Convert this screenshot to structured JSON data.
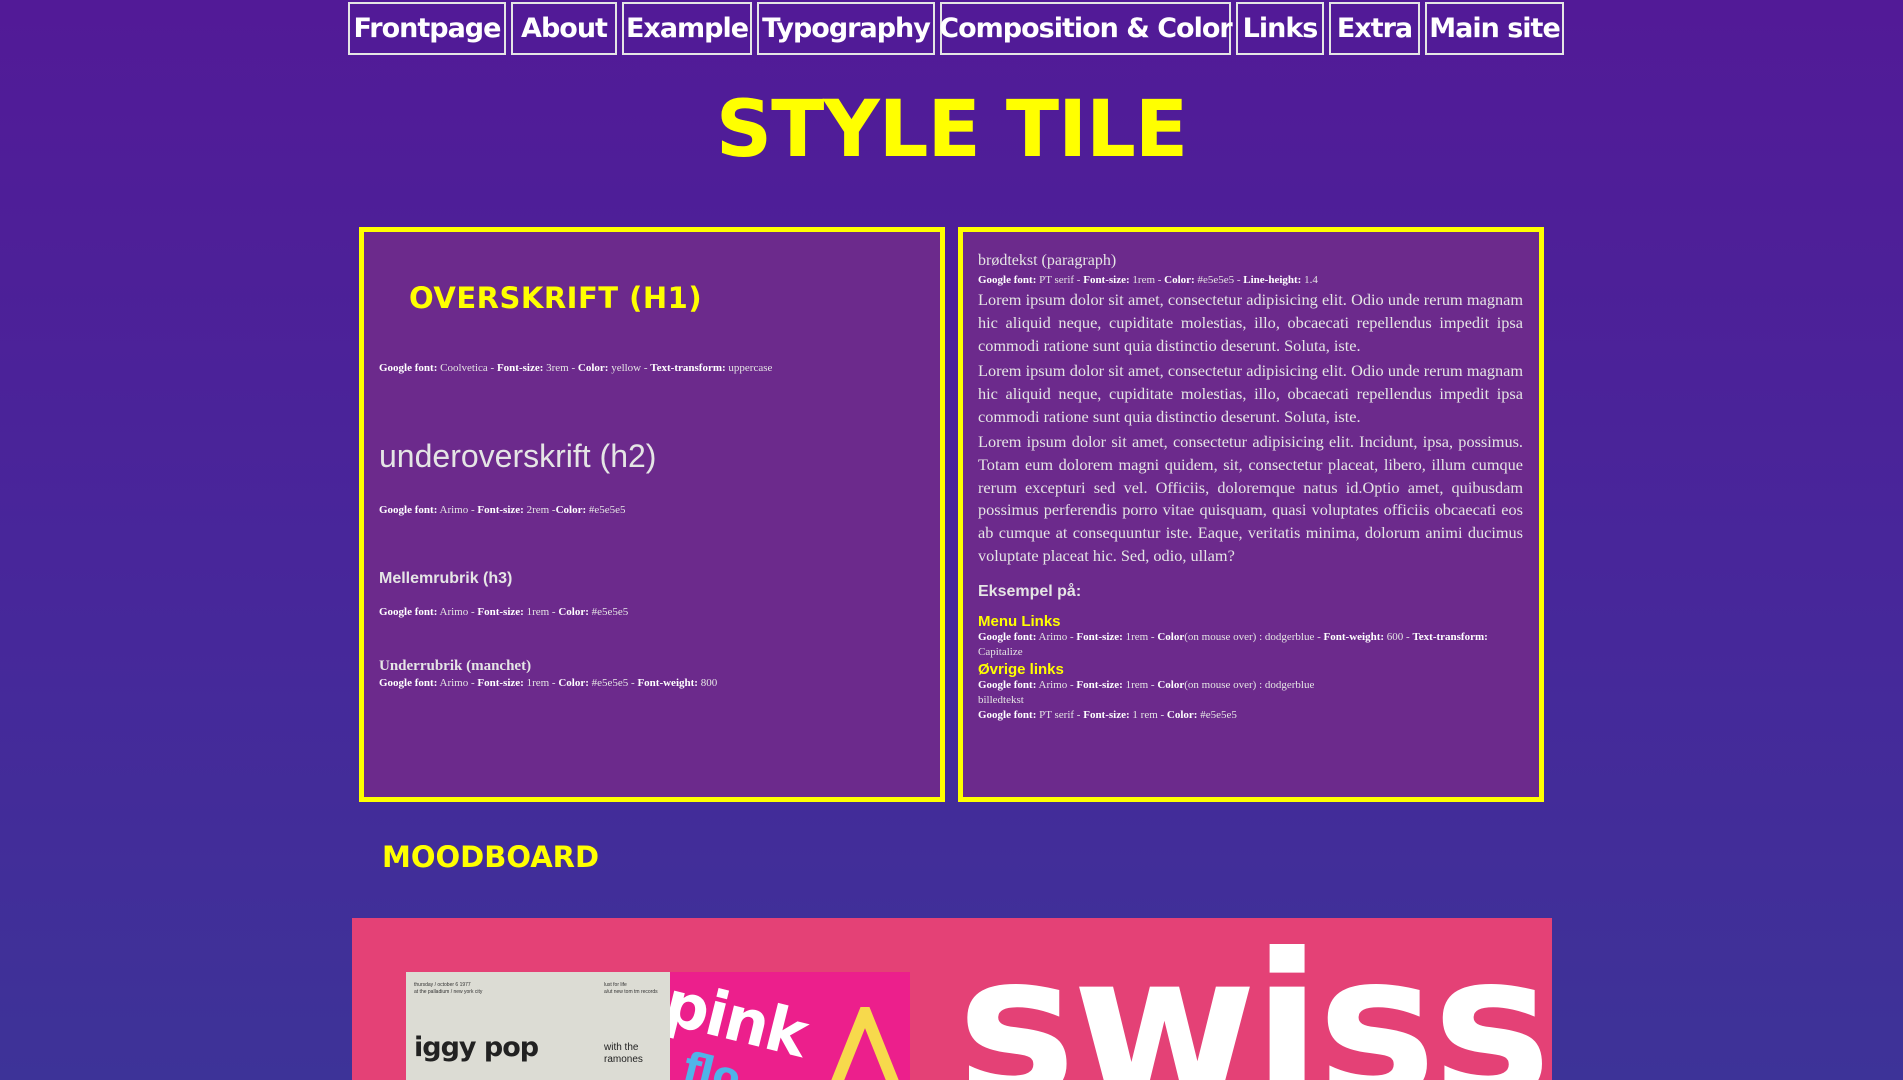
{
  "nav": [
    "Frontpage",
    "About",
    "Example",
    "Typography",
    "Composition & Color",
    "Links",
    "Extra",
    "Main site"
  ],
  "page_title": "STYLE TILE",
  "left_tile": {
    "h1_sample": "Overskrift (H1)",
    "h1_spec": {
      "k1": "Google font:",
      "v1": " Coolvetica - ",
      "k2": "Font-size:",
      "v2": " 3rem - ",
      "k3": "Color:",
      "v3": " yellow - ",
      "k4": "Text-transform:",
      "v4": " uppercase"
    },
    "h2_sample": "underoverskrift (h2)",
    "h2_spec": {
      "k1": "Google font:",
      "v1": " Arimo - ",
      "k2": "Font-size:",
      "v2": " 2rem -",
      "k3": "Color:",
      "v3": " #e5e5e5"
    },
    "h3_sample": "Mellemrubrik (h3)",
    "h3_spec": {
      "k1": "Google font:",
      "v1": " Arimo - ",
      "k2": "Font-size:",
      "v2": " 1rem - ",
      "k3": "Color:",
      "v3": " #e5e5e5"
    },
    "manchet_sample": "Underrubrik (manchet)",
    "manchet_spec": {
      "k1": "Google font:",
      "v1": " Arimo - ",
      "k2": "Font-size:",
      "v2": " 1rem - ",
      "k3": "Color:",
      "v3": " #e5e5e5 - ",
      "k4": "Font-weight:",
      "v4": " 800"
    }
  },
  "right_tile": {
    "para_heading": "brødtekst (paragraph)",
    "para_spec": {
      "k1": "Google font:",
      "v1": " PT serif - ",
      "k2": "Font-size:",
      "v2": " 1rem - ",
      "k3": "Color:",
      "v3": " #e5e5e5 - ",
      "k4": "Line-height:",
      "v4": " 1.4"
    },
    "paragraphs": [
      "Lorem ipsum dolor sit amet, consectetur adipisicing elit. Odio unde rerum magnam hic aliquid neque, cupiditate molestias, illo, obcaecati repellendus impedit ipsa commodi ratione sunt quia distinctio deserunt. Soluta, iste.",
      "Lorem ipsum dolor sit amet, consectetur adipisicing elit. Odio unde rerum magnam hic aliquid neque, cupiditate molestias, illo, obcaecati repellendus impedit ipsa commodi ratione sunt quia distinctio deserunt. Soluta, iste.",
      "Lorem ipsum dolor sit amet, consectetur adipisicing elit. Incidunt, ipsa, possimus. Totam eum dolorem magni quidem, sit, consectetur placeat, libero, illum cumque rerum excepturi sed vel. Officiis, doloremque natus id.Optio amet, quibusdam possimus perferendis porro vitae quisquam, quasi voluptates officiis obcaecati eos ab cumque at consequuntur iste. Eaque, veritatis minima, dolorum animi ducimus voluptate placeat hic. Sed, odio, ullam?"
    ],
    "example_heading": "Eksempel på:",
    "menu_links_label": "Menu Links",
    "menu_links_spec": {
      "k1": "Google font:",
      "v1": " Arimo - ",
      "k2": "Font-size:",
      "v2": " 1rem - ",
      "k3": "Color",
      "v3": "(on mouse over) : dodgerblue - ",
      "k4": "Font-weight:",
      "v4": " 600 - ",
      "k5": "Text-transform:",
      "v5": " Capitalize"
    },
    "other_links_label": "Øvrige links",
    "other_links_spec": {
      "k1": "Google font:",
      "v1": " Arimo - ",
      "k2": "Font-size:",
      "v2": " 1rem - ",
      "k3": "Color",
      "v3": "(on mouse over) : dodgerblue"
    },
    "image_text_label": "billedtekst",
    "image_text_spec": {
      "k1": "Google font:",
      "v1": " PT serif - ",
      "k2": "Font-size:",
      "v2": " 1 rem - ",
      "k3": "Color:",
      "v3": " #e5e5e5"
    }
  },
  "moodboard": {
    "title": "Moodboard",
    "poster1": {
      "top_left": "thursday / october 6 1977",
      "top_left2": "at the palladium / new york city",
      "top_right": "lust for life",
      "top_right2": "a/ut new tom tm records",
      "main": "iggy pop",
      "sub": "with the ramones"
    },
    "poster2": {
      "word": "pink",
      "word2": "flo"
    },
    "swiss_text": "swiss"
  },
  "colors": {
    "background_top": "#521a97",
    "background_bottom": "#3d3398",
    "accent": "#ffff00",
    "tile_bg": "#6c2a8c",
    "text": "#e5e5e5",
    "moodboard_bg": "#e44176"
  }
}
